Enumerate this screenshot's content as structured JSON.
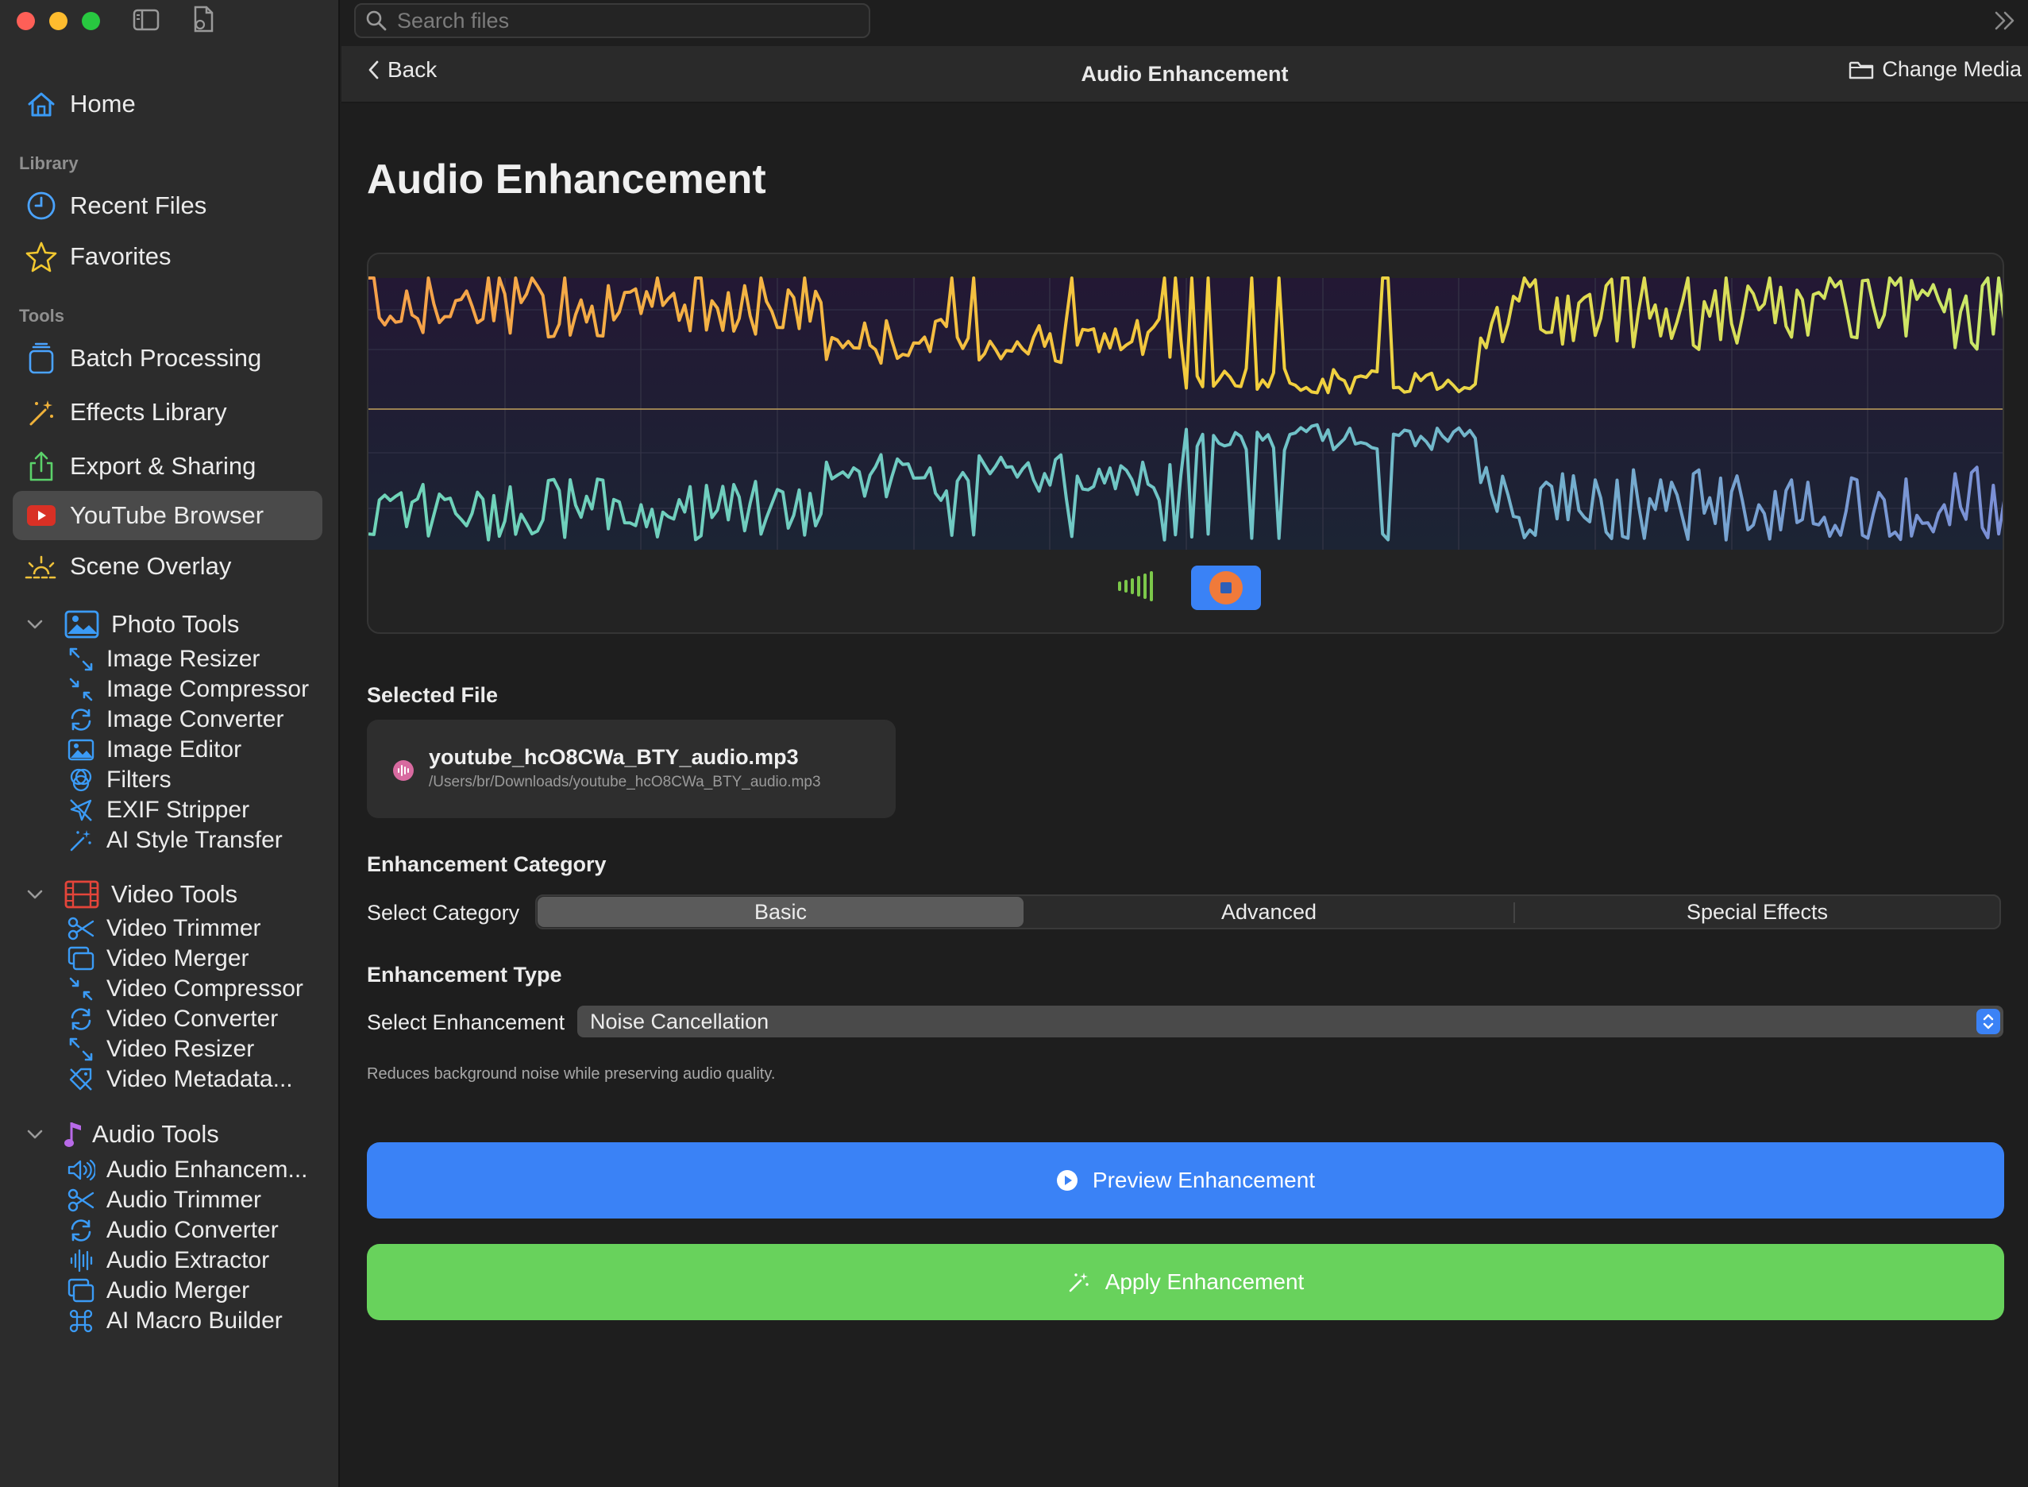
{
  "search": {
    "placeholder": "Search files"
  },
  "sidebar": {
    "home": "Home",
    "library_header": "Library",
    "library": [
      {
        "label": "Recent Files",
        "icon": "clock-icon"
      },
      {
        "label": "Favorites",
        "icon": "star-icon"
      }
    ],
    "tools_header": "Tools",
    "tools": [
      {
        "label": "Batch Processing",
        "icon": "stack-icon"
      },
      {
        "label": "Effects Library",
        "icon": "sparkle-wand-icon"
      },
      {
        "label": "Export & Sharing",
        "icon": "share-icon"
      },
      {
        "label": "YouTube Browser",
        "icon": "youtube-icon"
      },
      {
        "label": "Scene Overlay",
        "icon": "sunrise-icon"
      }
    ],
    "groups": [
      {
        "label": "Photo Tools",
        "items": [
          "Image Resizer",
          "Image Compressor",
          "Image Converter",
          "Image Editor",
          "Filters",
          "EXIF Stripper",
          "AI Style Transfer"
        ]
      },
      {
        "label": "Video Tools",
        "items": [
          "Video Trimmer",
          "Video Merger",
          "Video Compressor",
          "Video Converter",
          "Video Resizer",
          "Video Metadata..."
        ]
      },
      {
        "label": "Audio Tools",
        "items": [
          "Audio Enhancem...",
          "Audio Trimmer",
          "Audio Converter",
          "Audio Extractor",
          "Audio Merger",
          "AI Macro Builder"
        ]
      }
    ]
  },
  "navbar": {
    "back": "Back",
    "title": "Audio Enhancement",
    "change_media": "Change Media"
  },
  "main": {
    "title": "Audio Enhancement",
    "selected_file_label": "Selected File",
    "file_name": "youtube_hcO8CWa_BTY_audio.mp3",
    "file_path": "/Users/br/Downloads/youtube_hcO8CWa_BTY_audio.mp3",
    "category_header": "Enhancement Category",
    "category_label": "Select Category",
    "categories": [
      "Basic",
      "Advanced",
      "Special Effects"
    ],
    "selected_category": "Basic",
    "type_header": "Enhancement Type",
    "enhancement_label": "Select Enhancement",
    "enhancement_value": "Noise Cancellation",
    "description": "Reduces background noise while preserving audio quality.",
    "preview_button": "Preview Enhancement",
    "apply_button": "Apply Enhancement"
  },
  "colors": {
    "accent_blue": "#3a82f6",
    "apply_green": "#68d25c",
    "stop_orange": "#f07a3a",
    "wave_top_start": "#f5a04a",
    "wave_top_end": "#c9e86a",
    "wave_bottom_start": "#6fd4b8",
    "wave_bottom_end": "#7b8fd6"
  }
}
